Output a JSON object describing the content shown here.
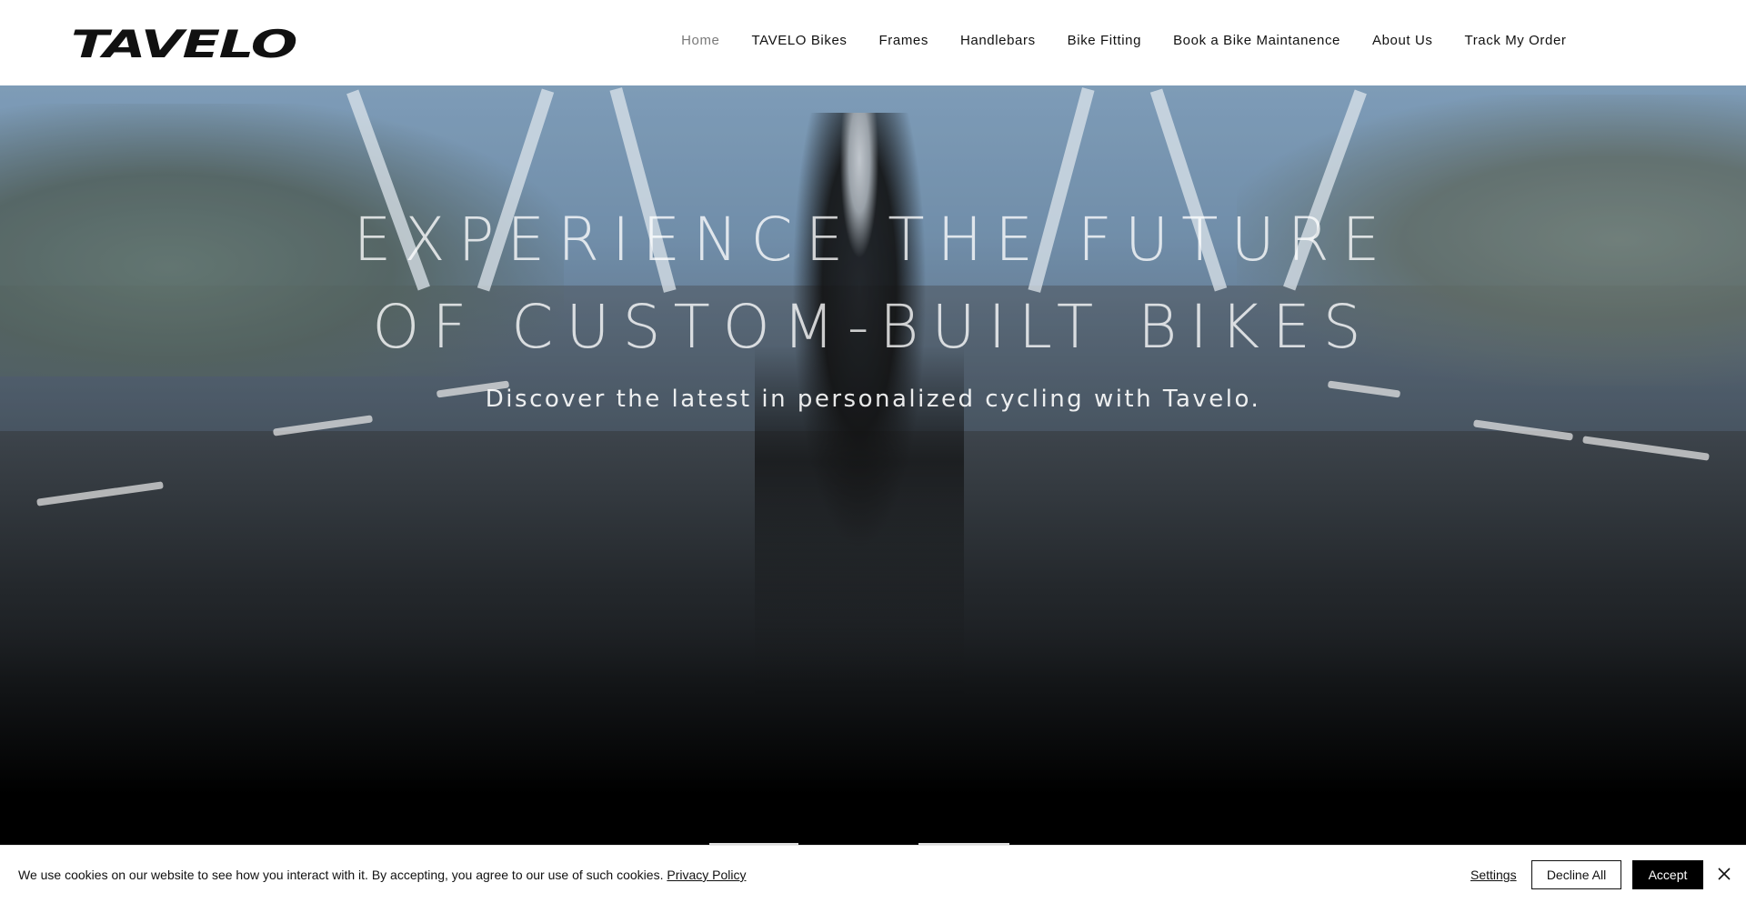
{
  "header": {
    "logo_text": "TAVELO",
    "nav": [
      {
        "label": "Home",
        "active": true
      },
      {
        "label": "TAVELO Bikes",
        "active": false
      },
      {
        "label": "Frames",
        "active": false
      },
      {
        "label": "Handlebars",
        "active": false
      },
      {
        "label": "Bike Fitting",
        "active": false
      },
      {
        "label": "Book a Bike Maintanence",
        "active": false
      },
      {
        "label": "About Us",
        "active": false
      },
      {
        "label": "Track My Order",
        "active": false
      }
    ]
  },
  "hero": {
    "title_line1": "EXPERIENCE THE FUTURE",
    "title_line2": "OF CUSTOM-BUILT BIKES",
    "subtitle": "Discover the latest in personalized cycling with Tavelo."
  },
  "cookie_banner": {
    "message": "We use cookies on our website to see how you interact with it. By accepting, you agree to our use of such cookies.",
    "policy_link": "Privacy Policy",
    "settings_label": "Settings",
    "decline_label": "Decline All",
    "accept_label": "Accept",
    "close_icon": "close-icon"
  },
  "colors": {
    "header_bg": "#ffffff",
    "nav_active": "#7a7a7a",
    "nav_text": "#111111",
    "accept_bg": "#000000"
  }
}
